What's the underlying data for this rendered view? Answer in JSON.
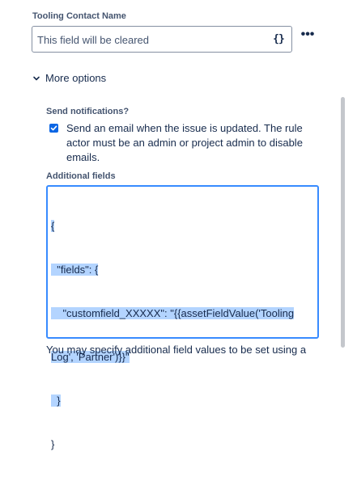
{
  "field": {
    "label": "Tooling Contact Name",
    "placeholder": "This field will be cleared",
    "smart_value_icon": "{}",
    "more_icon": "•••"
  },
  "more_options": {
    "label": "More options"
  },
  "notifications": {
    "label": "Send notifications?",
    "checkbox_text": "Send an email when the issue is updated. The rule actor must be an admin or project admin to disable emails.",
    "checked": true
  },
  "additional_fields": {
    "label": "Additional fields",
    "lines": [
      "{",
      "  \"fields\": {",
      "    \"customfield_XXXXX\": \"{{assetFieldValue('Tooling",
      "Log', 'Partner')}}\"",
      "  }",
      "}"
    ]
  },
  "footer": {
    "text": "You may specify additional field values to be set using a"
  },
  "colors": {
    "accent": "#0c66e4",
    "selection": "#b3d4ff",
    "focus_border": "#388bff"
  }
}
